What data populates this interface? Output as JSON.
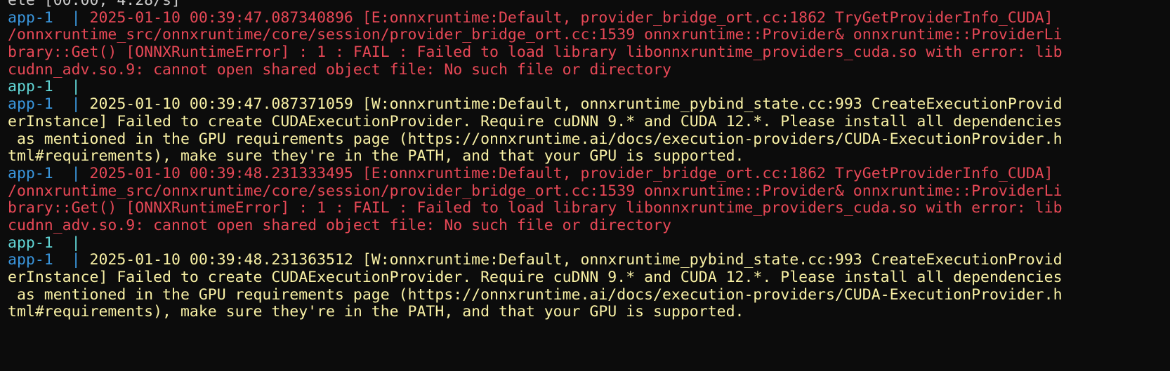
{
  "terminal": {
    "lines": [
      {
        "prefix": "",
        "text": "ete [00:00, 4.28/s]",
        "color": "cropped"
      },
      {
        "prefix": "app-1  | ",
        "prefix_color": "blue",
        "text": "2025-01-10 00:39:47.087340896 [E:onnxruntime:Default, provider_bridge_ort.cc:1862 TryGetProviderInfo_CUDA]",
        "color": "red"
      },
      {
        "prefix": "",
        "text": "/onnxruntime_src/onnxruntime/core/session/provider_bridge_ort.cc:1539 onnxruntime::Provider& onnxruntime::ProviderLi",
        "color": "red"
      },
      {
        "prefix": "",
        "text": "brary::Get() [ONNXRuntimeError] : 1 : FAIL : Failed to load library libonnxruntime_providers_cuda.so with error: lib",
        "color": "red"
      },
      {
        "prefix": "",
        "text": "cudnn_adv.so.9: cannot open shared object file: No such file or directory",
        "color": "red"
      },
      {
        "prefix": "app-1  | ",
        "prefix_color": "cyan",
        "text": "",
        "color": "red"
      },
      {
        "prefix": "app-1  | ",
        "prefix_color": "blue",
        "text": "2025-01-10 00:39:47.087371059 [W:onnxruntime:Default, onnxruntime_pybind_state.cc:993 CreateExecutionProvid",
        "color": "yellow"
      },
      {
        "prefix": "",
        "text": "erInstance] Failed to create CUDAExecutionProvider. Require cuDNN 9.* and CUDA 12.*. Please install all dependencies",
        "color": "yellow"
      },
      {
        "prefix": "",
        "text": " as mentioned in the GPU requirements page (https://onnxruntime.ai/docs/execution-providers/CUDA-ExecutionProvider.h",
        "color": "yellow"
      },
      {
        "prefix": "",
        "text": "tml#requirements), make sure they're in the PATH, and that your GPU is supported.",
        "color": "yellow"
      },
      {
        "prefix": "app-1  | ",
        "prefix_color": "blue",
        "text": "2025-01-10 00:39:48.231333495 [E:onnxruntime:Default, provider_bridge_ort.cc:1862 TryGetProviderInfo_CUDA]",
        "color": "red"
      },
      {
        "prefix": "",
        "text": "/onnxruntime_src/onnxruntime/core/session/provider_bridge_ort.cc:1539 onnxruntime::Provider& onnxruntime::ProviderLi",
        "color": "red"
      },
      {
        "prefix": "",
        "text": "brary::Get() [ONNXRuntimeError] : 1 : FAIL : Failed to load library libonnxruntime_providers_cuda.so with error: lib",
        "color": "red"
      },
      {
        "prefix": "",
        "text": "cudnn_adv.so.9: cannot open shared object file: No such file or directory",
        "color": "red"
      },
      {
        "prefix": "app-1  | ",
        "prefix_color": "cyan",
        "text": "",
        "color": "red"
      },
      {
        "prefix": "app-1  | ",
        "prefix_color": "blue",
        "text": "2025-01-10 00:39:48.231363512 [W:onnxruntime:Default, onnxruntime_pybind_state.cc:993 CreateExecutionProvid",
        "color": "yellow"
      },
      {
        "prefix": "",
        "text": "erInstance] Failed to create CUDAExecutionProvider. Require cuDNN 9.* and CUDA 12.*. Please install all dependencies",
        "color": "yellow"
      },
      {
        "prefix": "",
        "text": " as mentioned in the GPU requirements page (https://onnxruntime.ai/docs/execution-providers/CUDA-ExecutionProvider.h",
        "color": "yellow"
      },
      {
        "prefix": "",
        "text": "tml#requirements), make sure they're in the PATH, and that your GPU is supported.",
        "color": "yellow"
      },
      {
        "prefix": "",
        "text": "",
        "color": "cropped"
      }
    ],
    "colors": {
      "background": "#0c0c0c",
      "error_text": "#e74856",
      "warning_text": "#f9f1a5",
      "prefix_blue": "#3a96dd",
      "prefix_cyan": "#61d6d6"
    }
  }
}
